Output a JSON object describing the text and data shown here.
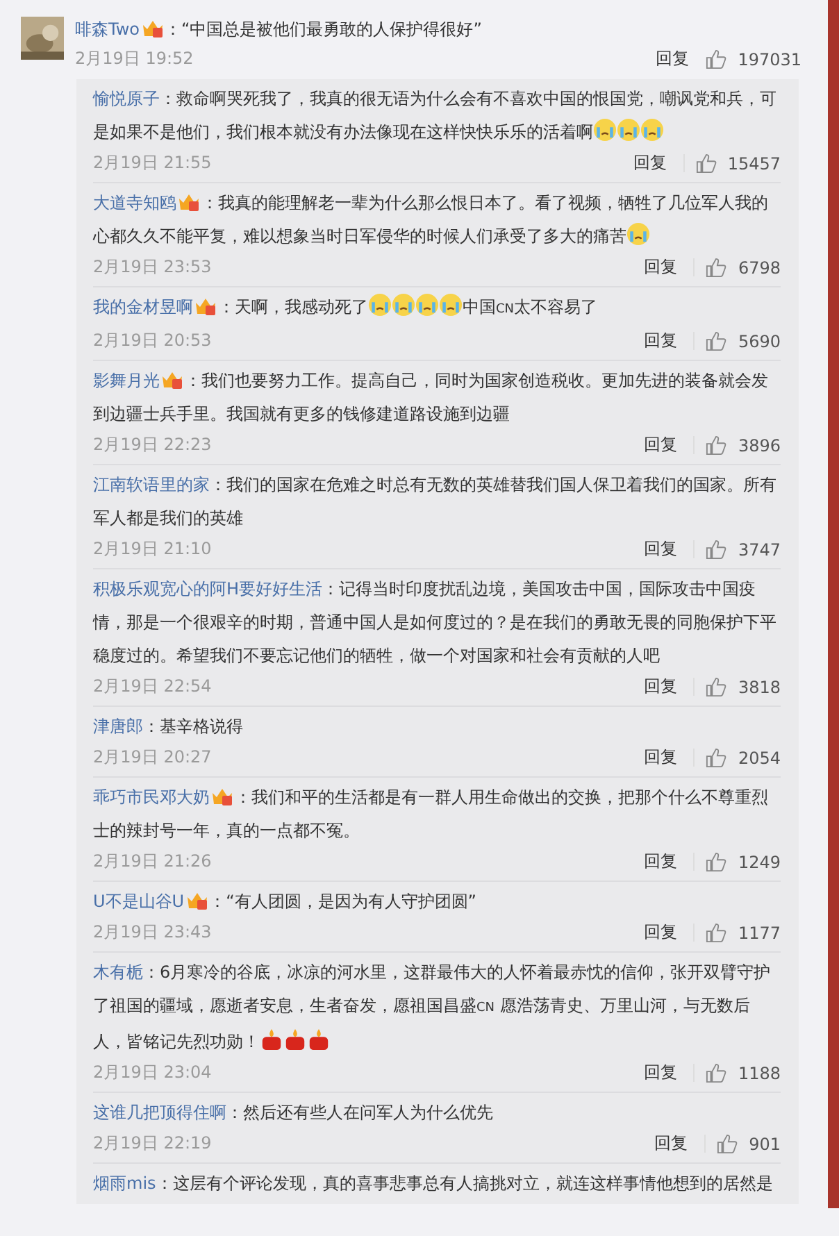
{
  "comment": {
    "user": "啡森Two",
    "badge": true,
    "parts": [
      {
        "kind": "text",
        "text": "：“中国总是被他们最勇敢的人保护得很好”"
      }
    ],
    "time": "2月19日 19:52",
    "reply": "回复",
    "likes": "197031"
  },
  "replies": [
    {
      "user": "愉悦原子",
      "badge": false,
      "parts": [
        {
          "kind": "text",
          "text": "：救命啊哭死我了，我真的很无语为什么会有不喜欢中国的恨国党，嘲讽党和兵，可是如果不是他们，我们根本就没有办法像现在这样快快乐乐的活着啊"
        },
        {
          "kind": "cry"
        },
        {
          "kind": "cry"
        },
        {
          "kind": "cry"
        }
      ],
      "time": "2月19日 21:55",
      "reply": "回复",
      "likes": "15457"
    },
    {
      "user": "大道寺知鸥",
      "badge": true,
      "parts": [
        {
          "kind": "text",
          "text": "：我真的能理解老一辈为什么那么恨日本了。看了视频，牺牲了几位军人我的心都久久不能平复，难以想象当时日军侵华的时候人们承受了多大的痛苦"
        },
        {
          "kind": "cry"
        }
      ],
      "time": "2月19日 23:53",
      "reply": "回复",
      "likes": "6798"
    },
    {
      "user": "我的金材昱啊",
      "badge": true,
      "parts": [
        {
          "kind": "text",
          "text": "：天啊，我感动死了"
        },
        {
          "kind": "cry"
        },
        {
          "kind": "cry"
        },
        {
          "kind": "cry"
        },
        {
          "kind": "cry"
        },
        {
          "kind": "text",
          "text": "中国"
        },
        {
          "kind": "small",
          "text": "CN"
        },
        {
          "kind": "text",
          "text": "太不容易了"
        }
      ],
      "time": "2月19日 20:53",
      "reply": "回复",
      "likes": "5690"
    },
    {
      "user": "影舞月光",
      "badge": true,
      "parts": [
        {
          "kind": "text",
          "text": "：我们也要努力工作。提高自己，同时为国家创造税收。更加先进的装备就会发到边疆士兵手里。我国就有更多的钱修建道路设施到边疆"
        }
      ],
      "time": "2月19日 22:23",
      "reply": "回复",
      "likes": "3896"
    },
    {
      "user": "江南软语里的家",
      "badge": false,
      "parts": [
        {
          "kind": "text",
          "text": "：我们的国家在危难之时总有无数的英雄替我们国人保卫着我们的国家。所有军人都是我们的英雄"
        }
      ],
      "time": "2月19日 21:10",
      "reply": "回复",
      "likes": "3747"
    },
    {
      "user": "积极乐观宽心的阿H要好好生活",
      "badge": false,
      "parts": [
        {
          "kind": "text",
          "text": "：记得当时印度扰乱边境，美国攻击中国，国际攻击中国疫情，那是一个很艰辛的时期，普通中国人是如何度过的？是在我们的勇敢无畏的同胞保护下平稳度过的。希望我们不要忘记他们的牺牲，做一个对国家和社会有贡献的人吧"
        }
      ],
      "time": "2月19日 22:54",
      "reply": "回复",
      "likes": "3818"
    },
    {
      "user": "津唐郎",
      "badge": false,
      "parts": [
        {
          "kind": "text",
          "text": "：基辛格说得"
        }
      ],
      "time": "2月19日 20:27",
      "reply": "回复",
      "likes": "2054"
    },
    {
      "user": "乖巧市民邓大奶",
      "badge": true,
      "parts": [
        {
          "kind": "text",
          "text": "：我们和平的生活都是有一群人用生命做出的交换，把那个什么不尊重烈士的辣封号一年，真的一点都不冤。"
        }
      ],
      "time": "2月19日 21:26",
      "reply": "回复",
      "likes": "1249"
    },
    {
      "user": "U不是山谷U",
      "badge": true,
      "parts": [
        {
          "kind": "text",
          "text": "：“有人团圆，是因为有人守护团圆”"
        }
      ],
      "time": "2月19日 23:43",
      "reply": "回复",
      "likes": "1177"
    },
    {
      "user": "木有栀",
      "badge": false,
      "parts": [
        {
          "kind": "text",
          "text": "：6月寒冷的谷底，冰凉的河水里，这群最伟大的人怀着最赤忱的信仰，张开双臂守护了祖国的疆域，愿逝者安息，生者奋发，愿祖国昌盛"
        },
        {
          "kind": "small",
          "text": "CN"
        },
        {
          "kind": "text",
          "text": " 愿浩荡青史、万里山河，与无数后人，皆铭记先烈功勋！"
        },
        {
          "kind": "candle"
        },
        {
          "kind": "candle"
        },
        {
          "kind": "candle"
        }
      ],
      "time": "2月19日 23:04",
      "reply": "回复",
      "likes": "1188"
    },
    {
      "user": "这谁几把顶得住啊",
      "badge": false,
      "parts": [
        {
          "kind": "text",
          "text": "：然后还有些人在问军人为什么优先"
        }
      ],
      "time": "2月19日 22:19",
      "reply": "回复",
      "likes": "901"
    },
    {
      "user": "烟雨mis",
      "badge": false,
      "parts": [
        {
          "kind": "text",
          "text": "：这层有个评论发现，真的喜事悲事总有人搞挑对立，就连这样事情他想到的居然是"
        }
      ]
    }
  ]
}
